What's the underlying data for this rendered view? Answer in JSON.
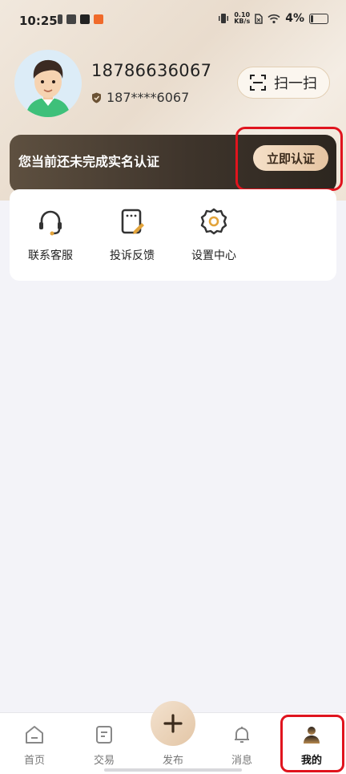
{
  "status_bar": {
    "time": "10:25",
    "speed_value": "0.10",
    "speed_unit": "KB/s",
    "battery": "4%"
  },
  "profile": {
    "phone": "18786636067",
    "masked_phone": "187****6067",
    "scan_label": "扫一扫"
  },
  "verify": {
    "text": "您当前还未完成实名认证",
    "button_label": "立即认证"
  },
  "menu": [
    {
      "label": "联系客服",
      "icon": "headset-icon"
    },
    {
      "label": "投诉反馈",
      "icon": "feedback-icon"
    },
    {
      "label": "设置中心",
      "icon": "gear-icon"
    }
  ],
  "tabs": [
    {
      "label": "首页",
      "icon": "home-icon"
    },
    {
      "label": "交易",
      "icon": "document-icon"
    },
    {
      "label": "发布",
      "icon": "plus-icon"
    },
    {
      "label": "消息",
      "icon": "bell-icon"
    },
    {
      "label": "我的",
      "icon": "user-icon",
      "active": true
    }
  ],
  "colors": {
    "accent_gold": "#e5c4a1",
    "dark_banner": "#3e342b",
    "highlight_red": "#e0141e"
  }
}
